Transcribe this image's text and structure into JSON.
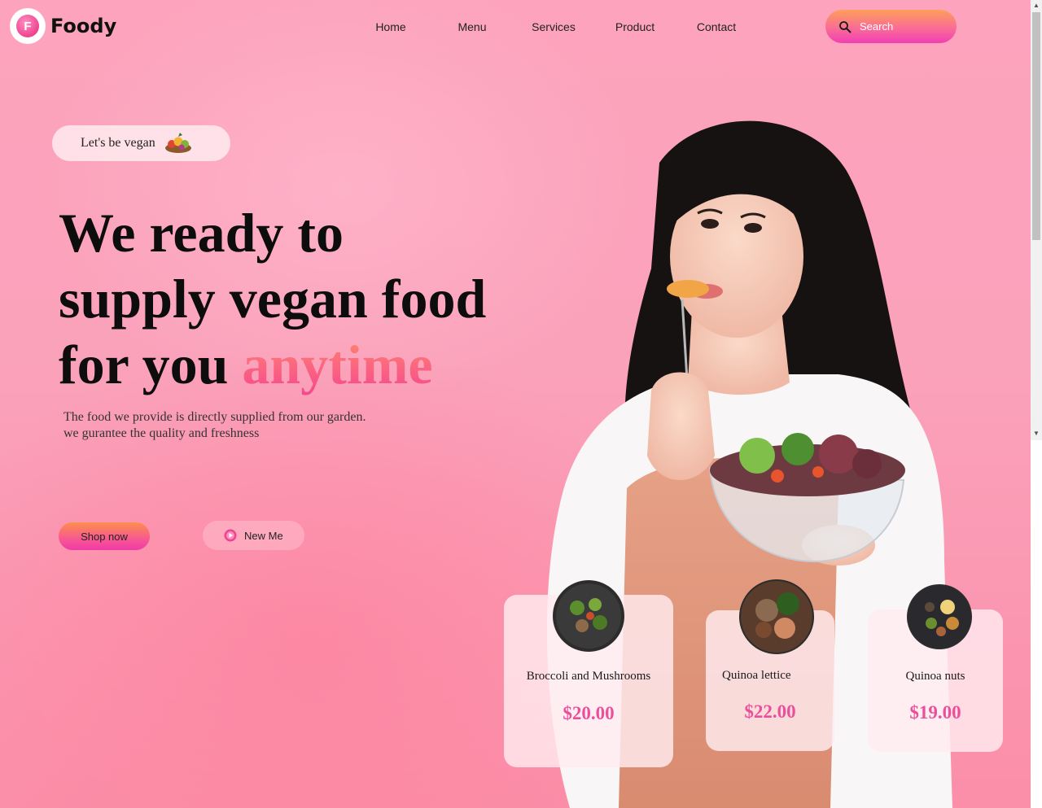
{
  "brand": {
    "name": "Foody",
    "logo_letter": "F"
  },
  "nav": {
    "items": [
      "Home",
      "Menu",
      "Services",
      "Product",
      "Contact"
    ]
  },
  "search": {
    "placeholder": "Search",
    "icon": "search-icon"
  },
  "hero": {
    "tag_label": "Let's be vegan",
    "tag_icon": "fruit-basket-icon",
    "headline_line1": "We ready to",
    "headline_line2": "supply vegan food",
    "headline_line3": "for you",
    "headline_accent": "anytime",
    "desc_line1": "The food we provide is directly supplied from our garden.",
    "desc_line2": "we gurantee the quality and freshness",
    "primary_button": "Shop now",
    "secondary_button": "New Me",
    "secondary_icon": "play-icon"
  },
  "products": [
    {
      "name": "Broccoli and Mushrooms",
      "price": "$20.00"
    },
    {
      "name": "Quinoa lettice",
      "price": "$22.00"
    },
    {
      "name": "Quinoa nuts",
      "price": "$19.00"
    }
  ],
  "colors": {
    "accent": "#ea4f9b",
    "background": "#fba2bb",
    "button_gradient_top": "#fd8f4b",
    "button_gradient_bottom": "#f03aa8"
  }
}
